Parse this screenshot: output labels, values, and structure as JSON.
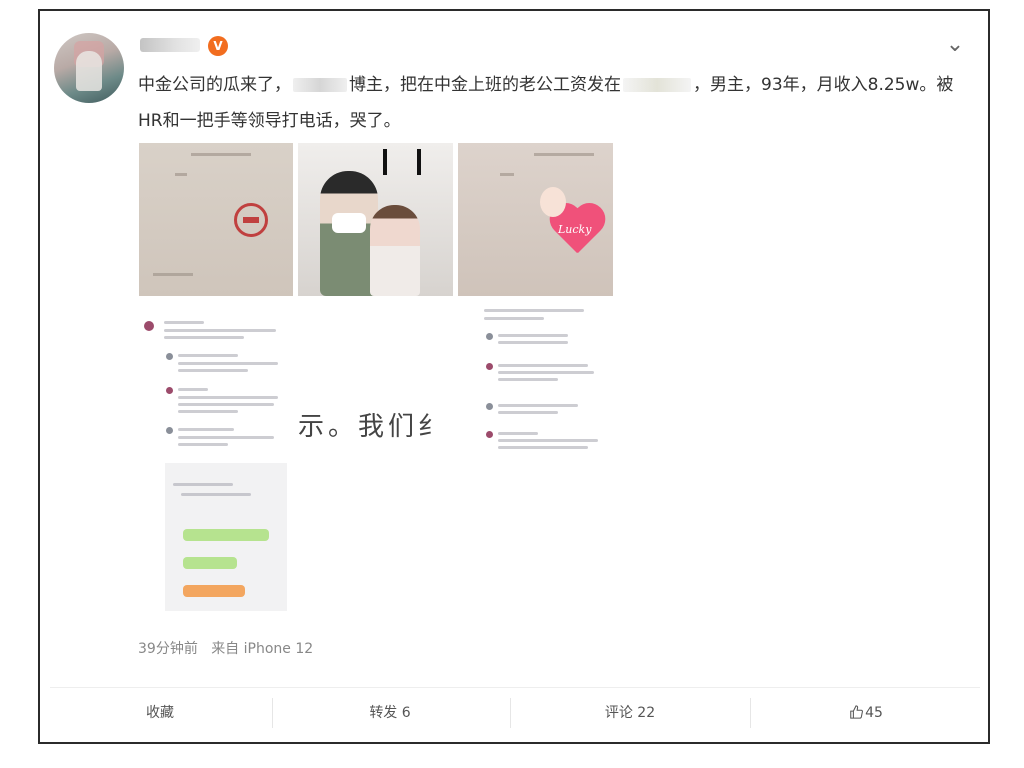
{
  "post": {
    "author_name": "",
    "badge_icon": "verified-badge-icon",
    "text_part1": "中金公司的瓜来了，",
    "text_part2": "博主，把在中金上班的老公工资发在",
    "text_part3": "，男主，93年，月收入8.25w。被HR和一把手等领导打电话，哭了。",
    "image_overlay_text": "示。我们纟",
    "lucky_label": "Lucky",
    "time": "39分钟前",
    "source": "来自 iPhone 12"
  },
  "actions": {
    "favorite": "收藏",
    "repost": "转发 6",
    "comment": "评论 22",
    "like_count": "45"
  },
  "colors": {
    "badge": "#f26d1f",
    "heart": "#f0517a",
    "stamp": "#c0403f"
  }
}
